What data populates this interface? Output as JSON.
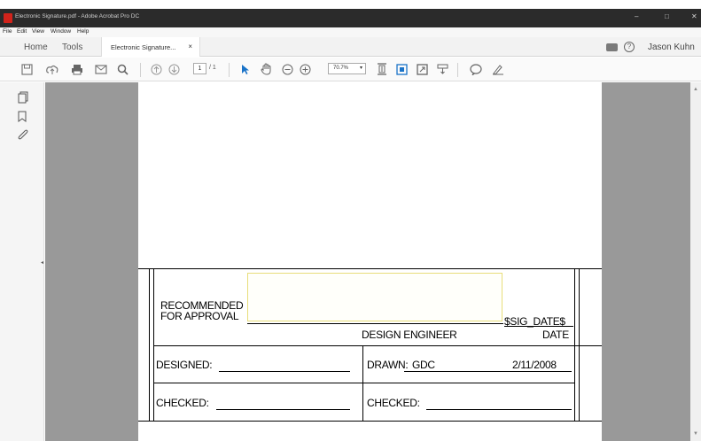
{
  "window": {
    "title": "Electronic Signature.pdf - Adobe Acrobat Pro DC",
    "minimize": "–",
    "maximize": "□",
    "close": "✕"
  },
  "menu": [
    "File",
    "Edit",
    "View",
    "Window",
    "Help"
  ],
  "tabs": {
    "home": "Home",
    "tools": "Tools",
    "document": "Electronic Signature...",
    "close": "×"
  },
  "user": {
    "name": "Jason Kuhn",
    "help": "?"
  },
  "toolbar": {
    "page_current": "1",
    "page_total": "/ 1",
    "zoom": "70.7%",
    "zoom_caret": "▾",
    "icons": [
      "save-icon",
      "upload-icon",
      "print-icon",
      "email-icon",
      "search-icon",
      "prev-page-icon",
      "next-page-icon",
      "select-tool-icon",
      "hand-tool-icon",
      "zoom-out-icon",
      "zoom-in-icon",
      "fit-page-icon",
      "scroll-mode-icon",
      "full-screen-icon",
      "stamp-icon",
      "comment-icon",
      "sign-icon"
    ]
  },
  "left_panel": {
    "icons": [
      "page-thumbnails-icon",
      "bookmark-icon",
      "attachment-icon"
    ],
    "collapse": "◂"
  },
  "scrollbar": {
    "up": "▲",
    "down": "▼"
  },
  "form": {
    "recommended_line1": "RECOMMENDED",
    "recommended_line2": "FOR APPROVAL",
    "sig_date_field": "$SIG_DATE$",
    "design_engineer": "DESIGN ENGINEER",
    "date": "DATE",
    "designed_label": "DESIGNED:",
    "drawn_label": "DRAWN:",
    "drawn_value": "GDC",
    "drawn_date": "2/11/2008",
    "checked_left": "CHECKED:",
    "checked_right": "CHECKED:"
  },
  "colors": {
    "acrobat_red": "#d2231b",
    "tool_blue": "#1a73c8",
    "canvas_gray": "#999999",
    "signature_field_border": "#e8dd7a"
  }
}
